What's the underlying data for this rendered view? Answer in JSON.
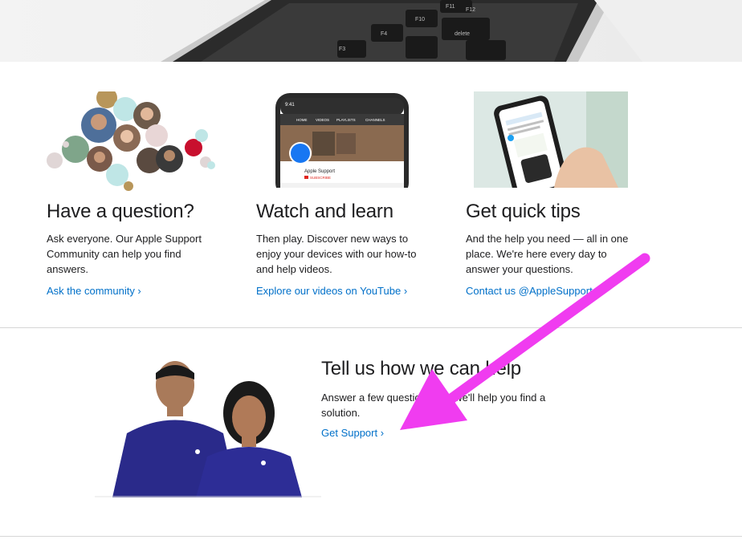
{
  "hero": {
    "keys": [
      "F3",
      "F4",
      "F10",
      "F11",
      "F12",
      "delete"
    ]
  },
  "cards": [
    {
      "title": "Have a question?",
      "body": "Ask everyone. Our Apple Support Community can help you find answers.",
      "link": "Ask the community ›"
    },
    {
      "title": "Watch and learn",
      "body": "Then play. Discover new ways to enjoy your devices with our how-to and help videos.",
      "link": "Explore our videos on YouTube ›",
      "phone": {
        "time": "9:41",
        "tabs": [
          "HOME",
          "VIDEOS",
          "PLAYLISTS",
          "CHANNELS"
        ],
        "channel": "Apple Support",
        "subscribe": "SUBSCRIBE"
      }
    },
    {
      "title": "Get quick tips",
      "body": "And the help you need — all in one place. We're here every day to answer your questions.",
      "link": "Contact us @AppleSupport ›"
    }
  ],
  "support": {
    "title": "Tell us how we can help",
    "body": "Answer a few questions and we'll help you find a solution.",
    "link": "Get Support ›"
  },
  "colors": {
    "link": "#0070c9",
    "annotation_arrow": "#f03cf0",
    "text": "#1d1d1f"
  }
}
